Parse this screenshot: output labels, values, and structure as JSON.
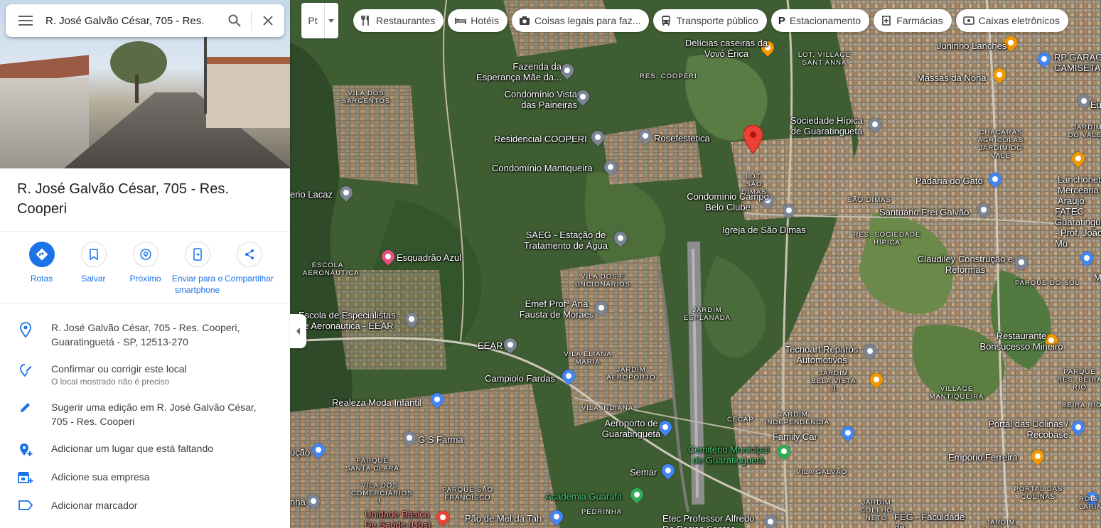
{
  "search": {
    "query": "R. José Galvão César, 705 - Res."
  },
  "place": {
    "title": "R. José Galvão César, 705 - Res. Cooperi"
  },
  "actions": [
    {
      "label": "Rotas",
      "icon": "directions-icon"
    },
    {
      "label": "Salvar",
      "icon": "bookmark-icon"
    },
    {
      "label": "Próximo",
      "icon": "nearby-icon"
    },
    {
      "label": "Enviar para o smartphone",
      "icon": "send-to-phone-icon"
    },
    {
      "label": "Compartilhar",
      "icon": "share-icon"
    }
  ],
  "info": {
    "address": "R. José Galvão César, 705 - Res. Cooperi, Guaratinguetá - SP, 12513-270",
    "confirm": "Confirmar ou corrigir este local",
    "confirm_sub": "O local mostrado não é preciso",
    "suggest": "Sugerir uma edição em R. José Galvão César, 705 - Res. Cooperi",
    "add_place": "Adicionar um lugar que está faltando",
    "add_business": "Adicione sua empresa",
    "add_label": "Adicionar marcador"
  },
  "layer_toggle": {
    "label": "Pt"
  },
  "chips": [
    {
      "label": "Restaurantes",
      "icon": "fork-knife-icon"
    },
    {
      "label": "Hotéis",
      "icon": "bed-icon"
    },
    {
      "label": "Coisas legais para faz...",
      "icon": "camera-icon"
    },
    {
      "label": "Transporte público",
      "icon": "bus-icon"
    },
    {
      "label": "Estacionamento",
      "icon": "parking-icon"
    },
    {
      "label": "Farmácias",
      "icon": "pharmacy-icon"
    },
    {
      "label": "Caixas eletrônicos",
      "icon": "atm-icon"
    }
  ],
  "map_labels": {
    "delicias": "Delícias caseiras da Vovó Érica",
    "lot_village": "LOT. VILLAGE SANT ANNA",
    "juninho": "Juninho Lanches",
    "rp_garage": "RP GARAG CAMISETA",
    "fazenda": "Fazenda da Esperança Mãe da...",
    "res_cooperi": "RES. COOPERI",
    "massas": "Massas da Nona",
    "vila_sargentos": "VILA DOS SARGENTOS",
    "condominio_vista": "Condomínio Vista das Paineiras",
    "sociedade_hipica": "Sociedade Hípica de Guaratinguetá",
    "chacaras": "CHÁCARAS AGRÍCOLAS JARDIM DO VALE",
    "residencial": "Residencial COOPERI",
    "rosefestetica": "Rosefestetica",
    "jardim_vale": "JARDIM DO VALE I",
    "condominio_mantiqueira": "Condomínio Mantiqueira",
    "lot_sao_dimas": "LOT. SÃO DIMAS",
    "padaria": "Padaria do Gato",
    "lanchonete": "Lanchonete e Mercearia Araujo",
    "lacaz": "erio Lacaz",
    "condominio_campo": "Condomínio Campo Belo Clube",
    "sao_dimas": "SÃO DIMAS",
    "santuario": "Santuário Frei Galvão",
    "fatec": "FATEC Guaratinguet - Prof. João Mo",
    "igreja": "Igreja de São Dimas",
    "saeg": "SAEG - Estação de Tratamento de Água",
    "res_sociedade": "RES. SOCIEDADE HÍPICA",
    "esquadrao": "Esquadrão Azul",
    "claudiley": "Claudiley Construção e Reformas",
    "escola_aero": "ESCOLA AERONÁUTICA",
    "vila_funcionarios": "VILA DOS F UNCIONÁRIOS",
    "parque_sol": "PARQUE DO SOL",
    "emef": "Emef Profª Ana Fausta de Moraes",
    "jardim_esplanada": "JARDIM ESPLANADA",
    "escola_especialistas": "Escola de Especialistas de Aeronáutica - EEAR",
    "restaurante_bonsucesso": "Restaurante Bonsucesso Mineiro",
    "eear": "EEAR",
    "tecnoart": "Tecnoart Reparos Automotivos",
    "vila_eliana": "VILA ELIANA MARIA",
    "jardim_aeroporto": "JARDIM AEROPORTO",
    "jardim_bela_vista": "JARDIM BELA VISTA II",
    "parque_beira": "PARQUE RES. BEIRA RIO",
    "campiolo": "Campiolo Fardas",
    "village_mantiqueira": "VILLAGE MANTIQUEIRA",
    "realeza": "Realeza Moda Infantil",
    "vila_indiana": "VILA INDIANA",
    "beira_rio": "BEIRA RIO I",
    "aeroporto": "Aeroporto de Guaratinguetá",
    "cecap": "CECAP",
    "jardim_independencia": "JARDIM INDEPENDÊNCIA",
    "portal_colinas": "Portal das Colinas / Recobase",
    "gs_farma": "G S Farma",
    "family_car": "Family Car",
    "cacao": "ução",
    "cemiterio": "Cemitério Municipal de Guaratinguetá",
    "emporio": "Empório Ferreira",
    "parque_santa_clara": "PARQUE SANTA CLARA",
    "semar": "Semar",
    "vila_galvao": "VILA GALVÃO",
    "vila_comerciarios": "VILA DOS COMERCIÁRIOS I",
    "parque_sao_francisco": "PARQUE SÃO FRANCISCO",
    "academia": "Academia Guarafit",
    "portal_das_colinas_area": "PORTAL DAS COLINAS",
    "nha": "nha",
    "unidade_basica": "Unidade Básica De Saúde (Ubs)",
    "pao_de_mel": "Pão de Mel da Tah",
    "pedrinha": "PEDRINHA",
    "etec": "Etec Professor Alfredo De Barros Santos",
    "jardim_coelho_neto": "JARDIM COELHO NETO",
    "feg": "FEG - Faculdade de",
    "jardim_tamandare": "JARDIM TAMANDARÉ",
    "rois_laria": "ROIS LARIA",
    "eu": "Eu",
    "m": "M"
  }
}
